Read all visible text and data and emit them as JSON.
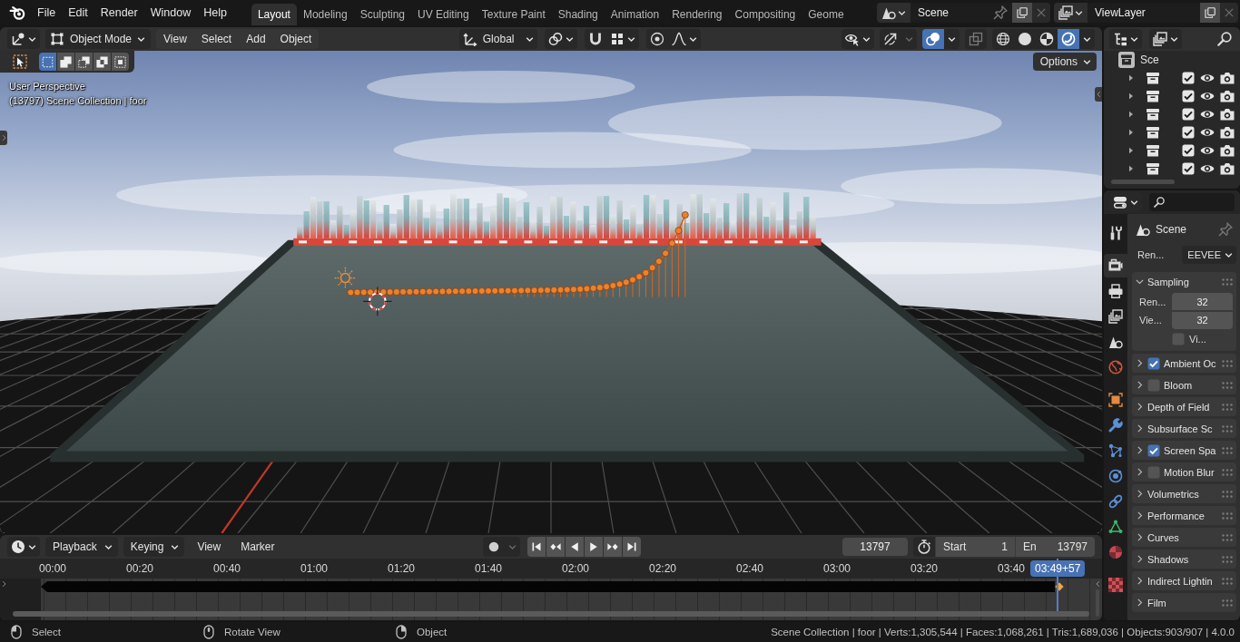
{
  "topbar": {
    "menus": [
      "File",
      "Edit",
      "Render",
      "Window",
      "Help"
    ],
    "workspaces": [
      {
        "label": "Layout",
        "selected": true
      },
      {
        "label": "Modeling",
        "selected": false
      },
      {
        "label": "Sculpting",
        "selected": false
      },
      {
        "label": "UV Editing",
        "selected": false
      },
      {
        "label": "Texture Paint",
        "selected": false
      },
      {
        "label": "Shading",
        "selected": false
      },
      {
        "label": "Animation",
        "selected": false
      },
      {
        "label": "Rendering",
        "selected": false
      },
      {
        "label": "Compositing",
        "selected": false
      },
      {
        "label": "Geome",
        "selected": false
      }
    ],
    "scene": "Scene",
    "view_layer": "ViewLayer"
  },
  "viewport": {
    "header": {
      "mode": "Object Mode",
      "menus": [
        "View",
        "Select",
        "Add",
        "Object"
      ],
      "orientation": "Global",
      "snap": {
        "on": false
      },
      "proportional": {
        "on": false
      },
      "gizmos": {
        "on": false
      },
      "overlays": {
        "on": true
      },
      "xray": {
        "on": false
      },
      "shading": [
        {
          "kind": "wireframe",
          "selected": false
        },
        {
          "kind": "solid",
          "selected": false
        },
        {
          "kind": "material",
          "selected": false
        },
        {
          "kind": "rendered",
          "selected": true
        }
      ]
    },
    "select_modes": [
      {
        "kind": "set",
        "selected": true
      },
      {
        "kind": "extend",
        "selected": false
      },
      {
        "kind": "subtract",
        "selected": false
      },
      {
        "kind": "invert",
        "selected": false
      },
      {
        "kind": "intersect",
        "selected": false
      }
    ],
    "options": "Options",
    "view_name": "User Perspective",
    "object_info": "(13797) Scene Collection | foor"
  },
  "outliner": {
    "root": {
      "label": "Sce",
      "children": [
        {
          "expanded": false,
          "checked": true
        },
        {
          "expanded": false,
          "checked": true
        },
        {
          "expanded": false,
          "checked": true
        },
        {
          "expanded": false,
          "checked": true
        },
        {
          "expanded": false,
          "checked": true
        },
        {
          "expanded": false,
          "checked": true
        }
      ]
    }
  },
  "properties": {
    "tabs": [
      {
        "kind": "tool",
        "selected": false
      },
      {
        "kind": "render",
        "selected": true
      },
      {
        "kind": "output",
        "selected": false
      },
      {
        "kind": "view_layer",
        "selected": false
      },
      {
        "kind": "scene",
        "selected": false
      },
      {
        "kind": "world",
        "selected": false
      },
      {
        "kind": "object",
        "selected": false
      },
      {
        "kind": "modifiers",
        "selected": false
      },
      {
        "kind": "particles",
        "selected": false
      },
      {
        "kind": "physics",
        "selected": false
      },
      {
        "kind": "constraints",
        "selected": false
      },
      {
        "kind": "data",
        "selected": false
      },
      {
        "kind": "material",
        "selected": false
      },
      {
        "kind": "texture",
        "selected": false
      }
    ],
    "context": "Scene",
    "engine_label": "Ren...",
    "engine": "EEVEE",
    "panels": [
      {
        "kind": "plain",
        "label": "Sampling",
        "expanded": true,
        "fields": [
          {
            "kind": "number",
            "label": "Ren...",
            "value": "32"
          },
          {
            "kind": "number",
            "label": "Vie...",
            "value": "32"
          },
          {
            "kind": "checkbox",
            "label": "Vi...",
            "checked": false
          }
        ]
      },
      {
        "kind": "toggle",
        "label": "Ambient Oc",
        "expanded": false,
        "checked": true
      },
      {
        "kind": "toggle",
        "label": "Bloom",
        "expanded": false,
        "checked": false
      },
      {
        "kind": "plain",
        "label": "Depth of Field",
        "expanded": false
      },
      {
        "kind": "plain",
        "label": "Subsurface Sc",
        "expanded": false
      },
      {
        "kind": "toggle",
        "label": "Screen Spa",
        "expanded": false,
        "checked": true
      },
      {
        "kind": "toggle",
        "label": "Motion Blur",
        "expanded": false,
        "checked": false
      },
      {
        "kind": "plain",
        "label": "Volumetrics",
        "expanded": false
      },
      {
        "kind": "plain",
        "label": "Performance",
        "expanded": false
      },
      {
        "kind": "plain",
        "label": "Curves",
        "expanded": false
      },
      {
        "kind": "plain",
        "label": "Shadows",
        "expanded": false
      },
      {
        "kind": "plain",
        "label": "Indirect Lightin",
        "expanded": false
      },
      {
        "kind": "plain",
        "label": "Film",
        "expanded": false
      }
    ]
  },
  "timeline": {
    "menus": [
      {
        "kind": "dropdown",
        "label": "Playback"
      },
      {
        "kind": "dropdown",
        "label": "Keying"
      },
      {
        "kind": "menu",
        "label": "View"
      },
      {
        "kind": "menu",
        "label": "Marker"
      }
    ],
    "auto_keying": {
      "on": false
    },
    "transport": [
      {
        "kind": "jump_start"
      },
      {
        "kind": "prev_key"
      },
      {
        "kind": "play_reverse"
      },
      {
        "kind": "play"
      },
      {
        "kind": "next_key"
      },
      {
        "kind": "jump_end"
      }
    ],
    "current_frame": "13797",
    "preview_range": {
      "on": false
    },
    "start_label": "Start",
    "start": "1",
    "end_label": "En",
    "end": "13797",
    "ruler_labels": [
      "00:00",
      "00:20",
      "00:40",
      "01:00",
      "01:20",
      "01:40",
      "02:00",
      "02:20",
      "02:40",
      "03:00",
      "03:20",
      "03:40"
    ],
    "current_time": "03:49+57"
  },
  "status_bar": {
    "hints": [
      {
        "kind": "left",
        "label": "Select"
      },
      {
        "kind": "middle",
        "label": "Rotate View"
      },
      {
        "kind": "right",
        "label": "Object"
      }
    ],
    "stats": "Scene Collection | foor | Verts:1,305,544 | Faces:1,068,261 | Tris:1,689,036 | Objects:903/907 | 4.0.0"
  }
}
